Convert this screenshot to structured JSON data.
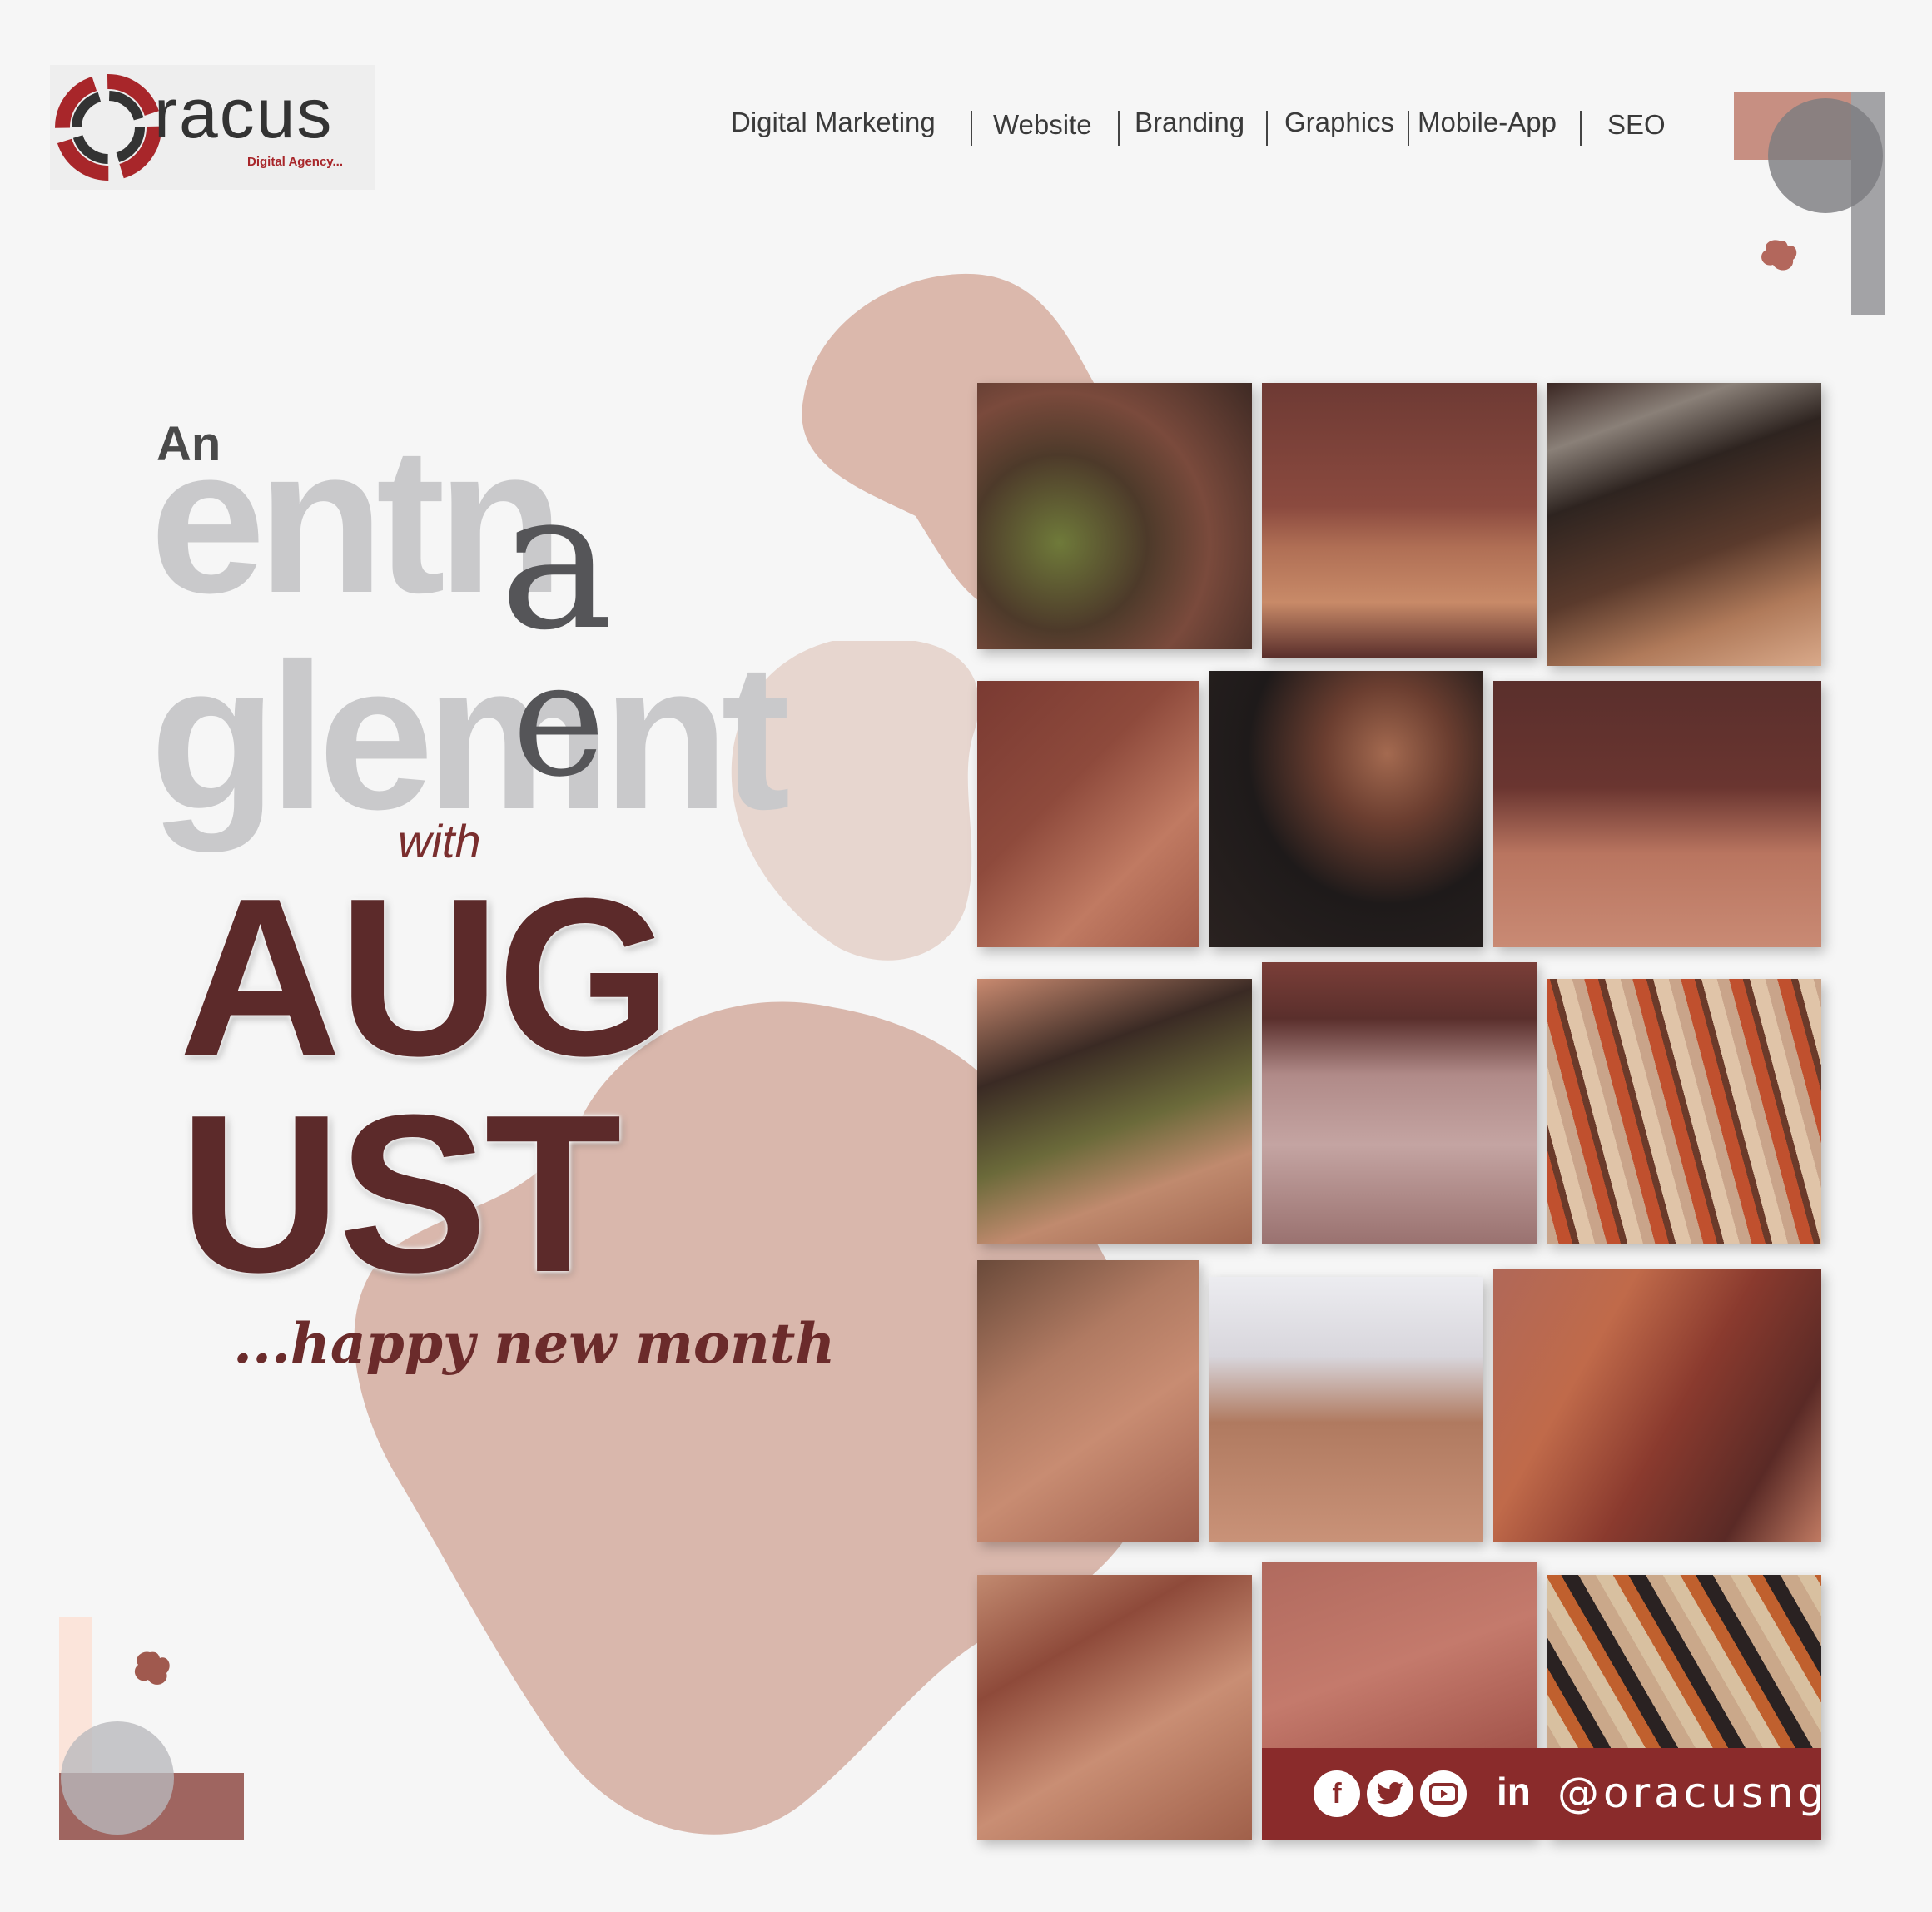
{
  "brand": {
    "name": "racus",
    "tagline": "Digital Agency...",
    "colors": {
      "primary": "#a8262a",
      "dark": "#5c2a2a",
      "blush": "#d9b7ac"
    }
  },
  "nav": {
    "items": [
      {
        "label": "Digital Marketing"
      },
      {
        "label": "Website"
      },
      {
        "label": "Branding"
      },
      {
        "label": "Graphics"
      },
      {
        "label": "Mobile-App"
      },
      {
        "label": "SEO"
      }
    ]
  },
  "headline": {
    "intro": "An",
    "word1": "entn",
    "word1_overlay": "a",
    "word2": "glemnt",
    "word2_overlay": "e",
    "connector": "with",
    "month_line1": "AUG",
    "month_line2": "UST",
    "greeting": "...happy new month"
  },
  "social": {
    "icons": [
      "facebook-icon",
      "twitter-icon",
      "youtube-icon",
      "linkedin-icon"
    ],
    "linkedin_text": "in",
    "handle": "@oracusng"
  }
}
